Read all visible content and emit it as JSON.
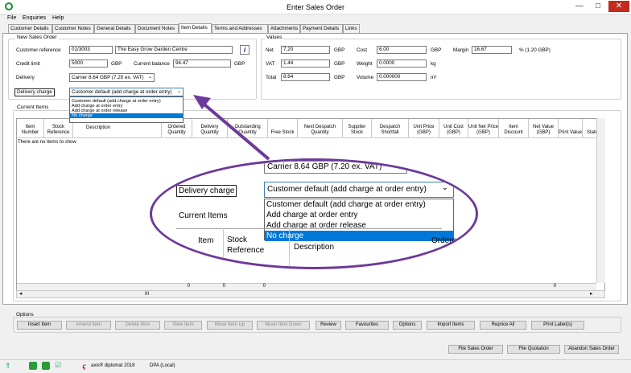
{
  "window": {
    "title": "Enter Sales Order",
    "min": "—",
    "max": "☐",
    "close": "✕"
  },
  "menu": [
    "File",
    "Enquiries",
    "Help"
  ],
  "tabs": [
    "Customer Details",
    "Customer Notes",
    "General Details",
    "Document Notes",
    "Item Details",
    "Terms and Addresses",
    "Attachments",
    "Payment Details",
    "Links"
  ],
  "new_sales_order": {
    "label": "New Sales Order",
    "customer_reference_label": "Customer reference",
    "customer_reference": "01/3003",
    "customer_name": "The Easy Grow Garden Centre",
    "info_icon": "i",
    "credit_limit_label": "Credit limit",
    "credit_limit": "5000",
    "credit_currency": "GBP",
    "current_balance_label": "Current balance",
    "current_balance": "94.47",
    "balance_currency": "GBP",
    "delivery_label": "Delivery",
    "delivery_value": "Carrier 8.64 GBP (7.20 ex. VAT)",
    "delivery_charge_label": "Delivery charge",
    "delivery_charge_value": "Customer default (add charge at order entry)"
  },
  "dropdown_options": [
    "Customer default (add charge at order entry)",
    "Add charge at order entry",
    "Add charge at order release",
    "No charge"
  ],
  "values": {
    "label": "Values",
    "net_label": "Net",
    "net": "7.20",
    "net_cur": "GBP",
    "vat_label": "VAT",
    "vat": "1.44",
    "vat_cur": "GBP",
    "total_label": "Total",
    "total": "8.64",
    "total_cur": "GBP",
    "cost_label": "Cost",
    "cost": "6.00",
    "cost_cur": "GBP",
    "weight_label": "Weight",
    "weight": "0.0000",
    "weight_unit": "kg",
    "volume_label": "Volume",
    "volume": "0.000000",
    "volume_unit": "m³",
    "margin_label": "Margin",
    "margin": "16.67",
    "margin_note": "% (1.20 GBP)"
  },
  "current_items": {
    "label": "Current Items",
    "empty_text": "There are no items to show",
    "columns": [
      "Item Number",
      "Stock Reference",
      "Description",
      "Ordered Quantity",
      "Delivery Quantity",
      "Outstanding Quantity",
      "Free Stock",
      "Next Despatch Quantity",
      "Supplier Stock",
      "Despatch Shortfall",
      "Unit Price (GBP)",
      "Unit Cost (GBP)",
      "Unit Net Price (GBP)",
      "Item Discount",
      "Net Value (GBP)",
      "Print Value",
      "Status"
    ],
    "totals": [
      "0",
      "0",
      "0",
      "0"
    ],
    "scroll_thumb": "III"
  },
  "options": {
    "label": "Options",
    "buttons": [
      "Insert Item",
      "Amend Item",
      "Delete Item",
      "View Item",
      "Move Item Up",
      "Move Item Down",
      "Review",
      "Favourites",
      "Options",
      "Import Items",
      "Reprice All",
      "Print Label(s)"
    ]
  },
  "bottom_buttons": [
    "File Sales Order",
    "File Quotation",
    "Abandon Sales Order"
  ],
  "statusbar": {
    "app": "axis® diplomat 2018",
    "db": "DPA (Local)"
  },
  "zoom": {
    "delivery_value": "Carrier 8.64 GBP (7.20 ex. VAT)",
    "delivery_charge_label": "Delivery charge",
    "delivery_charge_value": "Customer default (add charge at order entry)",
    "current_items": "Current Items",
    "col_item": "Item",
    "col_stock": "Stock",
    "col_stock2": "Reference",
    "col_desc": "Description",
    "col_ordered": "Ordered"
  },
  "colors": {
    "highlight": "#0078d7",
    "arrow": "#6c3a9a",
    "close": "#c42b1c"
  }
}
